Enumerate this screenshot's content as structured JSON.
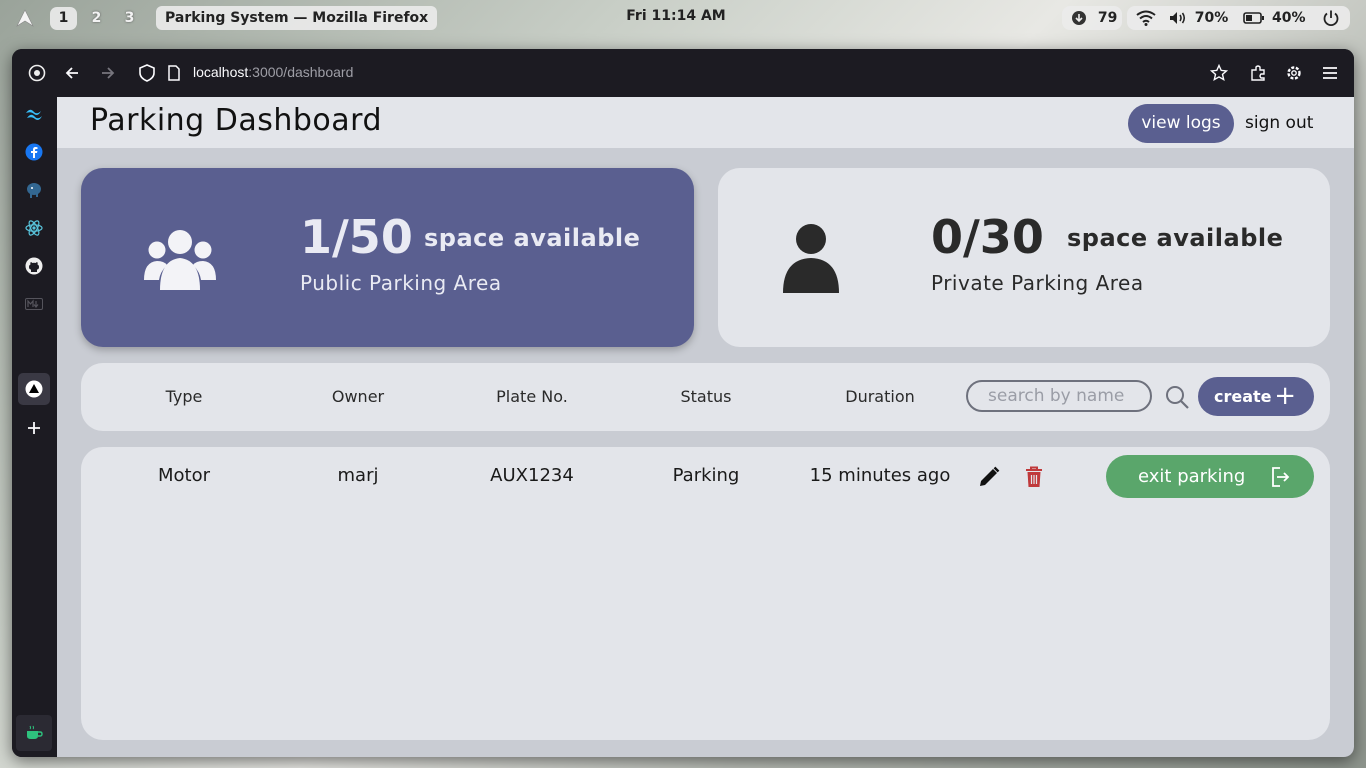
{
  "system": {
    "workspaces": [
      "1",
      "2",
      "3"
    ],
    "window_title": "Parking System — Mozilla Firefox",
    "clock": "Fri 11:14 AM",
    "updates": "79",
    "volume": "70%",
    "battery": "40%"
  },
  "browser": {
    "url_host": "localhost",
    "url_path": ":3000/dashboard"
  },
  "header": {
    "title": "Parking Dashboard",
    "view_logs": "view logs",
    "sign_out": "sign out"
  },
  "cards": {
    "public": {
      "count": "1/50",
      "label": "space available",
      "area": "Public Parking Area",
      "icon": "group-users-icon"
    },
    "private": {
      "count": "0/30",
      "label": "space available",
      "area": "Private Parking Area",
      "icon": "user-icon"
    }
  },
  "table": {
    "columns": [
      "Type",
      "Owner",
      "Plate No.",
      "Status",
      "Duration"
    ],
    "search_placeholder": "search by name",
    "create_label": "create",
    "rows": [
      {
        "type": "Motor",
        "owner": "marj",
        "plate": "AUX1234",
        "status": "Parking",
        "duration": "15 minutes ago",
        "exit_label": "exit parking"
      }
    ]
  },
  "colors": {
    "accent": "#5a5f90",
    "exit_green": "#5aa66b",
    "delete_red": "#c0393b",
    "panel": "#e3e5ea",
    "background": "#c9ccd3"
  }
}
